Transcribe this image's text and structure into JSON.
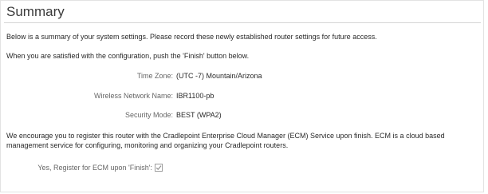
{
  "summary": {
    "title": "Summary",
    "intro": "Below is a summary of your system settings. Please record these newly established router settings for future access.",
    "instruction": "When you are satisfied with the configuration, push the 'Finish' button below.",
    "fields": [
      {
        "label": "Time Zone:",
        "value": "(UTC -7) Mountain/Arizona"
      },
      {
        "label": "Wireless Network Name:",
        "value": "IBR1100-pb"
      },
      {
        "label": "Security Mode:",
        "value": "BEST (WPA2)"
      }
    ],
    "ecm_note": "We encourage you to register this router with the Cradlepoint Enterprise Cloud Manager (ECM) Service upon finish. ECM is a cloud based management service for configuring, monitoring and organizing your Cradlepoint routers.",
    "ecm_checkbox": {
      "label": "Yes, Register for ECM upon 'Finish':",
      "checked": true
    }
  }
}
